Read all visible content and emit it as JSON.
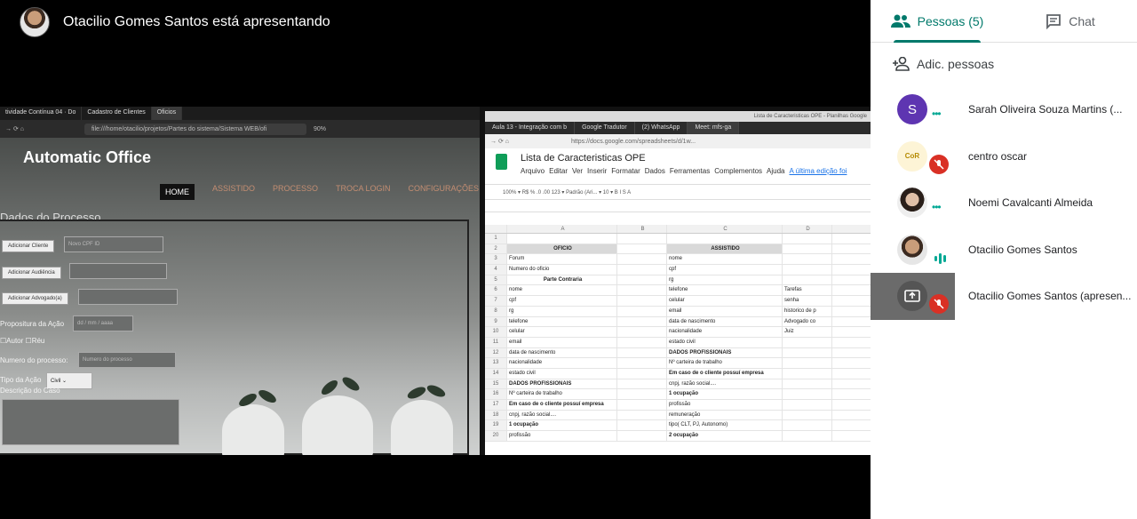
{
  "presenter": {
    "text": "Otacilio Gomes Santos está apresentando"
  },
  "left_browser": {
    "tabs": [
      "tividade Contínua 04 · Do",
      "Cadastro de Clientes",
      "Oficios"
    ],
    "url": "file:///home/otacilio/projetos/Partes do sistema/Sistema WEB/ofi",
    "zoom": "90%",
    "app_title": "Automatic Office",
    "nav": [
      "HOME",
      "ASSISTIDO",
      "PROCESSO",
      "TROCA LOGIN",
      "CONFIGURAÇÕES"
    ],
    "section_title": "Dados do Processo",
    "buttons": [
      "Adicionar Cliente",
      "Adicionar Audiência",
      "Adicionar Advogado(a)"
    ],
    "cpf_placeholder": "Novo CPF ID",
    "propositura_label": "Propositura da Ação",
    "date_placeholder": "dd / mm / aaaa",
    "autor_label": "Autor",
    "reu_label": "Réu",
    "numero_label": "Numero do processo:",
    "numero_placeholder": "Numero do processo",
    "tipo_label": "Tipo da Ação",
    "tipo_value": "Civil",
    "descricao_label": "Descrição do Caso"
  },
  "right_browser": {
    "window_title": "Lista de Caracteristicas OPE - Planilhas Google",
    "tabs": [
      "Aula 13 - Integração com b",
      "Google Tradutor",
      "(2) WhatsApp",
      "Meet: mfs-ga"
    ],
    "url": "https://docs.google.com/spreadsheets/d/1w...",
    "sheet_title": "Lista de Caracteristicas OPE",
    "menu": [
      "Arquivo",
      "Editar",
      "Ver",
      "Inserir",
      "Formatar",
      "Dados",
      "Ferramentas",
      "Complementos",
      "Ajuda"
    ],
    "last_edit": "A última edição foi",
    "toolbar": "100% ▾   R$  %  .0  .00  123 ▾   Padrão (Ari... ▾   10 ▾   B  I  S  A",
    "columns": [
      "A",
      "B",
      "C",
      "D"
    ],
    "rows": [
      [
        "1",
        "",
        "",
        "",
        ""
      ],
      [
        "2",
        "OFICIO",
        "",
        "ASSISTIDO",
        ""
      ],
      [
        "3",
        "Forum",
        "",
        "nome",
        ""
      ],
      [
        "4",
        "Numero do oficio",
        "",
        "cpf",
        ""
      ],
      [
        "5",
        "Parte Contraria",
        "",
        "rg",
        ""
      ],
      [
        "6",
        "nome",
        "",
        "telefone",
        "Tarefas"
      ],
      [
        "7",
        "cpf",
        "",
        "celular",
        "senha"
      ],
      [
        "8",
        "rg",
        "",
        "email",
        "historico de p"
      ],
      [
        "9",
        "telefone",
        "",
        "data de nascimento",
        "Advogado co"
      ],
      [
        "10",
        "celular",
        "",
        "nacionalidade",
        "Juiz"
      ],
      [
        "11",
        "email",
        "",
        "estado civil",
        ""
      ],
      [
        "12",
        "data de nascimento",
        "",
        "DADOS PROFISSIONAIS",
        ""
      ],
      [
        "13",
        "nacionalidade",
        "",
        "Nº carteira de trabalho",
        ""
      ],
      [
        "14",
        "estado civil",
        "",
        "Em caso de o cliente possuí empresa",
        ""
      ],
      [
        "15",
        "DADOS PROFISSIONAIS",
        "",
        "cnpj, razão social....",
        ""
      ],
      [
        "16",
        "Nº carteira de trabalho",
        "",
        "1 ocupação",
        ""
      ],
      [
        "17",
        "Em caso de o cliente possuí empresa",
        "",
        "profissão",
        ""
      ],
      [
        "18",
        "cnpj, razão social....",
        "",
        "remuneração",
        ""
      ],
      [
        "19",
        "1 ocupação",
        "",
        "tipo( CLT, PJ, Autonomo)",
        ""
      ],
      [
        "20",
        "profissão",
        "",
        "2 ocupação",
        ""
      ]
    ]
  },
  "side_panel": {
    "tab_people": "Pessoas (5)",
    "tab_chat": "Chat",
    "add_people": "Adic. pessoas",
    "participants": [
      {
        "name": "Sarah Oliveira Souza Martins (...",
        "initial": "S",
        "avatar_color": "#5e35b1",
        "status": "speaking-dots"
      },
      {
        "name": "centro oscar",
        "initial": "",
        "status": "muted"
      },
      {
        "name": "Noemi Cavalcanti Almeida",
        "initial": "",
        "status": "speaking-dots"
      },
      {
        "name": "Otacilio Gomes Santos",
        "initial": "",
        "status": "audio-active"
      },
      {
        "name": "Otacilio Gomes Santos (apresen...",
        "initial": "",
        "status": "muted"
      }
    ],
    "accent_color": "#00796b"
  }
}
